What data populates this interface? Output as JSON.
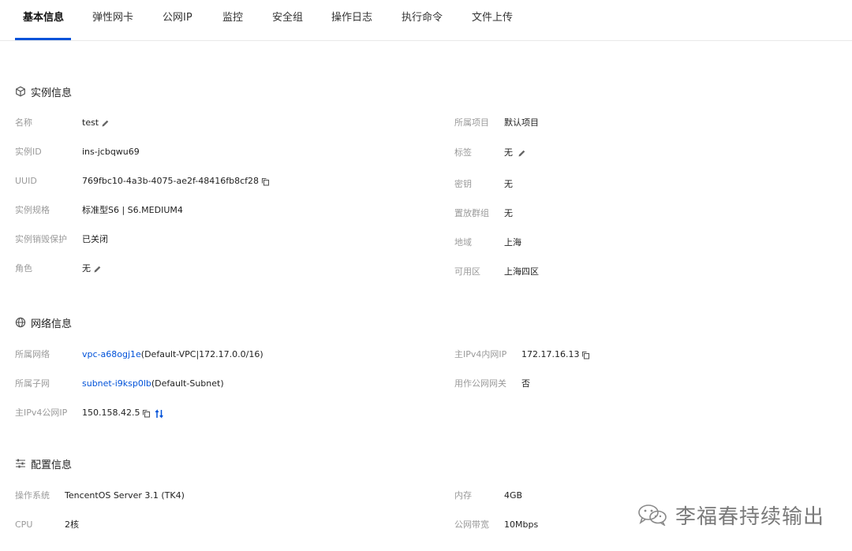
{
  "tabs": [
    {
      "label": "基本信息",
      "active": true
    },
    {
      "label": "弹性网卡"
    },
    {
      "label": "公网IP"
    },
    {
      "label": "监控"
    },
    {
      "label": "安全组"
    },
    {
      "label": "操作日志"
    },
    {
      "label": "执行命令"
    },
    {
      "label": "文件上传"
    }
  ],
  "instance": {
    "title": "实例信息",
    "left": [
      {
        "label": "名称",
        "value": "test"
      },
      {
        "label": "实例ID",
        "value": "ins-jcbqwu69"
      },
      {
        "label": "UUID",
        "value": "769fbc10-4a3b-4075-ae2f-48416fb8cf28"
      },
      {
        "label": "实例规格",
        "value": "标准型S6 | S6.MEDIUM4"
      },
      {
        "label": "实例销毁保护",
        "value": "已关闭"
      },
      {
        "label": "角色",
        "value": "无"
      }
    ],
    "right": [
      {
        "label": "所属项目",
        "value": "默认项目"
      },
      {
        "label": "标签",
        "value": "无"
      },
      {
        "label": "密钥",
        "value": "无"
      },
      {
        "label": "置放群组",
        "value": "无"
      },
      {
        "label": "地域",
        "value": "上海"
      },
      {
        "label": "可用区",
        "value": "上海四区"
      }
    ]
  },
  "network": {
    "title": "网络信息",
    "left": [
      {
        "label": "所属网络",
        "link": "vpc-a68ogj1e",
        "value": "(Default-VPC|172.17.0.0/16)"
      },
      {
        "label": "所属子网",
        "link": "subnet-i9ksp0lb",
        "value": "(Default-Subnet)"
      },
      {
        "label": "主IPv4公网IP",
        "value": "150.158.42.5"
      }
    ],
    "right": [
      {
        "label": "主IPv4内网IP",
        "value": "172.17.16.13"
      },
      {
        "label": "用作公网网关",
        "value": "否"
      }
    ]
  },
  "config": {
    "title": "配置信息",
    "left": [
      {
        "label": "操作系统",
        "value": "TencentOS Server 3.1 (TK4)"
      },
      {
        "label": "CPU",
        "value": "2核"
      }
    ],
    "right": [
      {
        "label": "内存",
        "value": "4GB"
      },
      {
        "label": "公网带宽",
        "value": "10Mbps"
      }
    ]
  },
  "watermark": {
    "text": "李福春持续输出"
  },
  "colors": {
    "accent": "#0052d9",
    "label": "#9a9a9a"
  },
  "icons": [
    "edit-icon",
    "copy-icon",
    "swap-icon",
    "cube-icon",
    "globe-icon",
    "sliders-icon",
    "wechat-icon"
  ]
}
